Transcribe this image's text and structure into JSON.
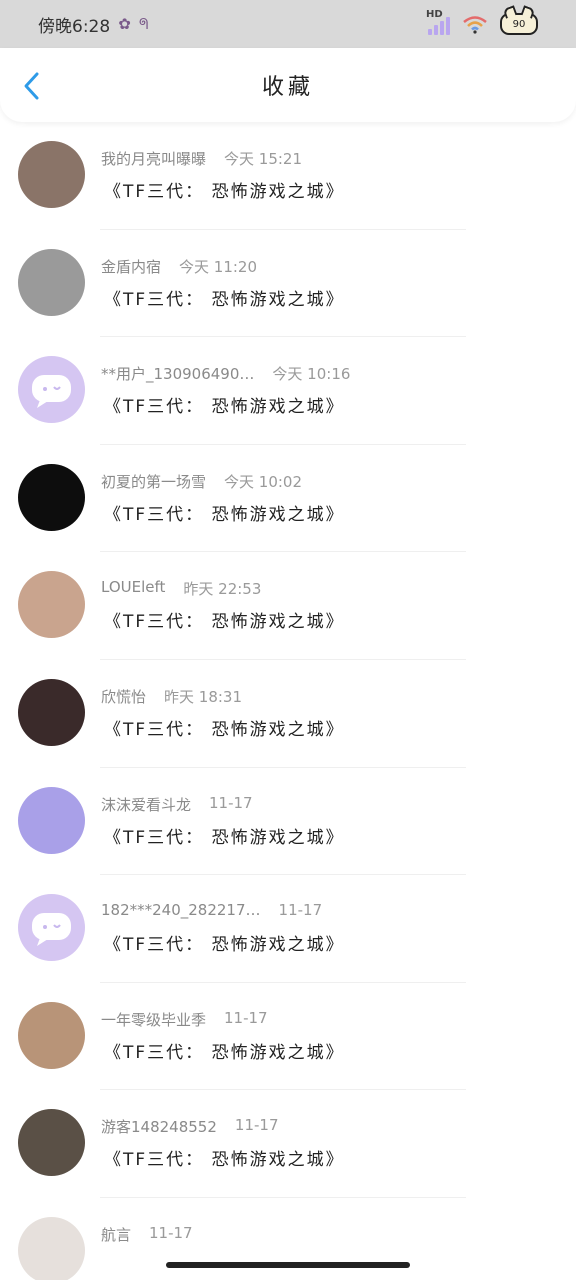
{
  "status_bar": {
    "time": "傍晚6:28",
    "extra_icons": [
      "✿",
      "ᖗ"
    ],
    "hd_label": "HD",
    "battery_level": "90"
  },
  "nav": {
    "title": "收藏"
  },
  "items": [
    {
      "user": "我的月亮叫曝曝",
      "time": "今天 15:21",
      "content": "《TF三代： 恐怖游戏之城》",
      "avatar_color": "#8a7468"
    },
    {
      "user": "金盾内宿",
      "time": "今天 11:20",
      "content": "《TF三代： 恐怖游戏之城》",
      "avatar_color": "#9a9a9a"
    },
    {
      "user": "**用户_130906490…",
      "time": "今天 10:16",
      "content": "《TF三代： 恐怖游戏之城》",
      "avatar_color": "#d5c6f2"
    },
    {
      "user": "初夏的第一场雪",
      "time": "今天 10:02",
      "content": "《TF三代： 恐怖游戏之城》",
      "avatar_color": "#0d0d0d"
    },
    {
      "user": "LOUEleft",
      "time": "昨天 22:53",
      "content": "《TF三代： 恐怖游戏之城》",
      "avatar_color": "#c9a48e"
    },
    {
      "user": "欣慌怡",
      "time": "昨天 18:31",
      "content": "《TF三代： 恐怖游戏之城》",
      "avatar_color": "#3a2a2a"
    },
    {
      "user": "沫沫爱看斗龙",
      "time": "11-17",
      "content": "《TF三代： 恐怖游戏之城》",
      "avatar_color": "#a9a0e8"
    },
    {
      "user": "182***240_282217…",
      "time": "11-17",
      "content": "《TF三代： 恐怖游戏之城》",
      "avatar_color": "#d5c6f2"
    },
    {
      "user": "一年零级毕业季",
      "time": "11-17",
      "content": "《TF三代： 恐怖游戏之城》",
      "avatar_color": "#b89478"
    },
    {
      "user": "游客148248552",
      "time": "11-17",
      "content": "《TF三代： 恐怖游戏之城》",
      "avatar_color": "#5a5046"
    },
    {
      "user": "航言",
      "time": "11-17",
      "content": "",
      "avatar_color": "#e6e0dc"
    }
  ]
}
